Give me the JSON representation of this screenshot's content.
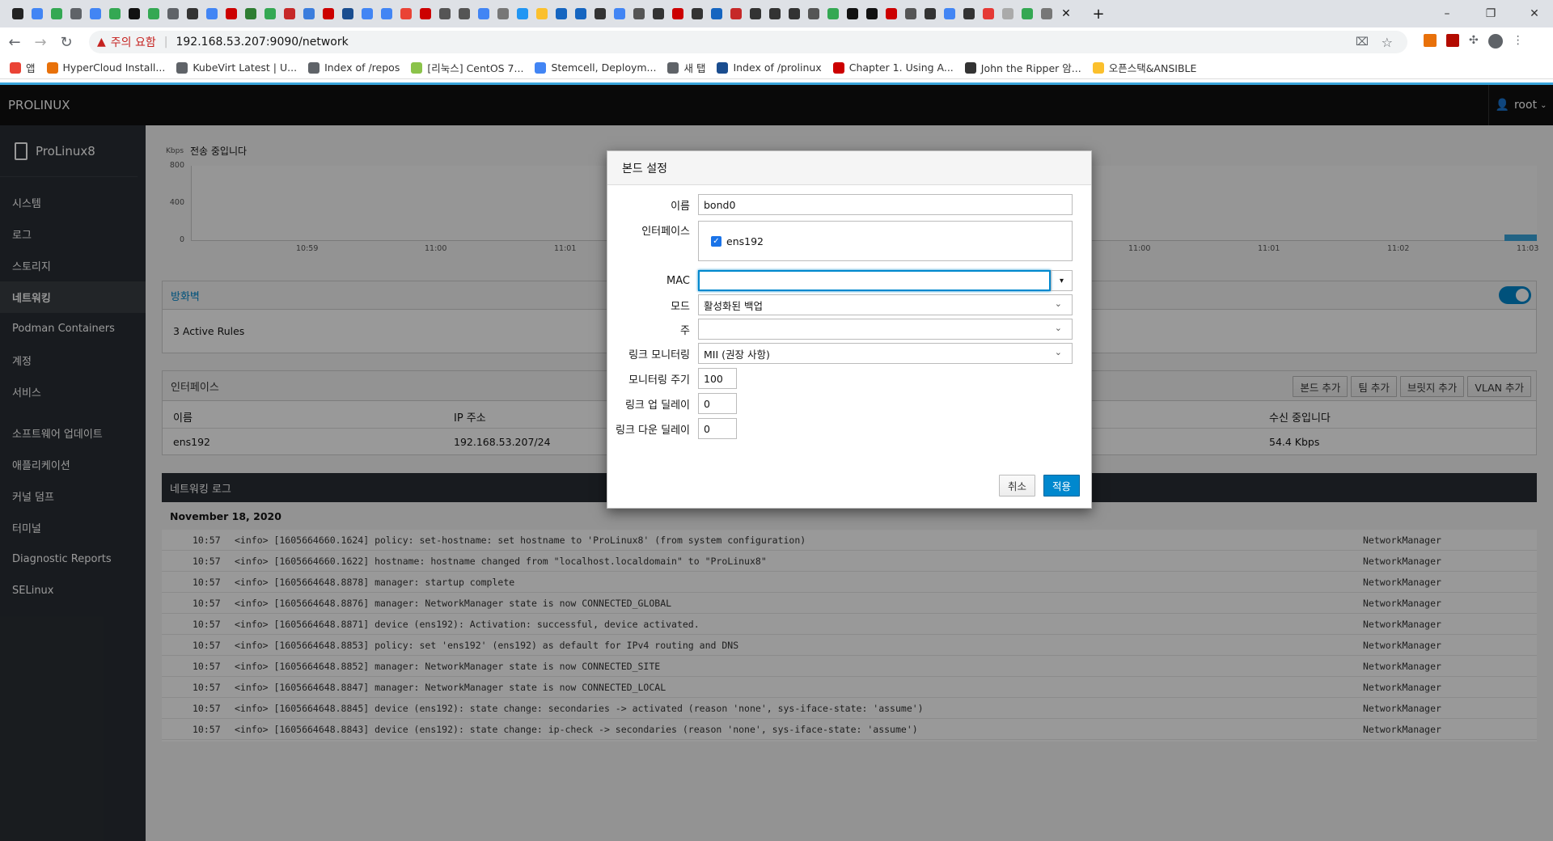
{
  "browser": {
    "url_warning": "주의 요함",
    "url": "192.168.53.207:9090/network",
    "bookmarks": [
      "앱",
      "HyperCloud Install...",
      "KubeVirt Latest | U...",
      "Index of /repos",
      "[리눅스] CentOS 7...",
      "Stemcell, Deploym...",
      "새 탭",
      "Index of /prolinux",
      "Chapter 1. Using A...",
      "John the Ripper 암...",
      "오픈스택&ANSIBLE"
    ]
  },
  "app": {
    "brand": "PROLINUX",
    "user": "root",
    "host": "ProLinux8"
  },
  "sidebar": {
    "items": [
      "시스템",
      "로그",
      "스토리지",
      "네트워킹",
      "Podman Containers",
      "계정",
      "서비스",
      "소프트웨어 업데이트",
      "애플리케이션",
      "커널 덤프",
      "터미널",
      "Diagnostic Reports",
      "SELinux"
    ]
  },
  "graph": {
    "unit": "Kbps",
    "title": "전송 중입니다",
    "yticks": [
      "800",
      "400",
      "0"
    ],
    "xticks_left": [
      "10:59",
      "11:00",
      "11:01"
    ],
    "xticks_right": [
      "11:00",
      "11:01",
      "11:02",
      "11:03"
    ]
  },
  "firewall": {
    "title": "방화벽",
    "rules": "3 Active Rules"
  },
  "interfaces": {
    "title": "인터페이스",
    "buttons": [
      "본드 추가",
      "팀 추가",
      "브릿지 추가",
      "VLAN 추가"
    ],
    "col_name": "이름",
    "col_ip": "IP 주소",
    "col_rx": "수신 중입니다",
    "row": {
      "name": "ens192",
      "ip": "192.168.53.207/24",
      "rx": "54.4 Kbps"
    }
  },
  "logs": {
    "title": "네트워킹 로그",
    "date": "November 18, 2020",
    "rows": [
      {
        "time": "10:57",
        "msg": "<info> [1605664660.1624] policy: set-hostname: set hostname to 'ProLinux8' (from system configuration)",
        "src": "NetworkManager"
      },
      {
        "time": "10:57",
        "msg": "<info> [1605664660.1622] hostname: hostname changed from \"localhost.localdomain\" to \"ProLinux8\"",
        "src": "NetworkManager"
      },
      {
        "time": "10:57",
        "msg": "<info> [1605664648.8878] manager: startup complete",
        "src": "NetworkManager"
      },
      {
        "time": "10:57",
        "msg": "<info> [1605664648.8876] manager: NetworkManager state is now CONNECTED_GLOBAL",
        "src": "NetworkManager"
      },
      {
        "time": "10:57",
        "msg": "<info> [1605664648.8871] device (ens192): Activation: successful, device activated.",
        "src": "NetworkManager"
      },
      {
        "time": "10:57",
        "msg": "<info> [1605664648.8853] policy: set 'ens192' (ens192) as default for IPv4 routing and DNS",
        "src": "NetworkManager"
      },
      {
        "time": "10:57",
        "msg": "<info> [1605664648.8852] manager: NetworkManager state is now CONNECTED_SITE",
        "src": "NetworkManager"
      },
      {
        "time": "10:57",
        "msg": "<info> [1605664648.8847] manager: NetworkManager state is now CONNECTED_LOCAL",
        "src": "NetworkManager"
      },
      {
        "time": "10:57",
        "msg": "<info> [1605664648.8845] device (ens192): state change: secondaries -> activated (reason 'none', sys-iface-state: 'assume')",
        "src": "NetworkManager"
      },
      {
        "time": "10:57",
        "msg": "<info> [1605664648.8843] device (ens192): state change: ip-check -> secondaries (reason 'none', sys-iface-state: 'assume')",
        "src": "NetworkManager"
      }
    ]
  },
  "modal": {
    "title": "본드 설정",
    "name_label": "이름",
    "name_value": "bond0",
    "interfaces_label": "인터페이스",
    "iface": "ens192",
    "mac_label": "MAC",
    "mac_value": "",
    "mode_label": "모드",
    "mode_value": "활성화된 백업",
    "primary_label": "주",
    "primary_value": "",
    "monitor_label": "링크 모니터링",
    "monitor_value": "MII (권장 사항)",
    "interval_label": "모니터링 주기",
    "interval_value": "100",
    "updelay_label": "링크 업 딜레이",
    "updelay_value": "0",
    "downdelay_label": "링크 다운 딜레이",
    "downdelay_value": "0",
    "cancel": "취소",
    "apply": "적용"
  },
  "colors": {
    "accent": "#39a5dc",
    "primary_button": "#0088ce",
    "toggle": "#0088ce"
  }
}
